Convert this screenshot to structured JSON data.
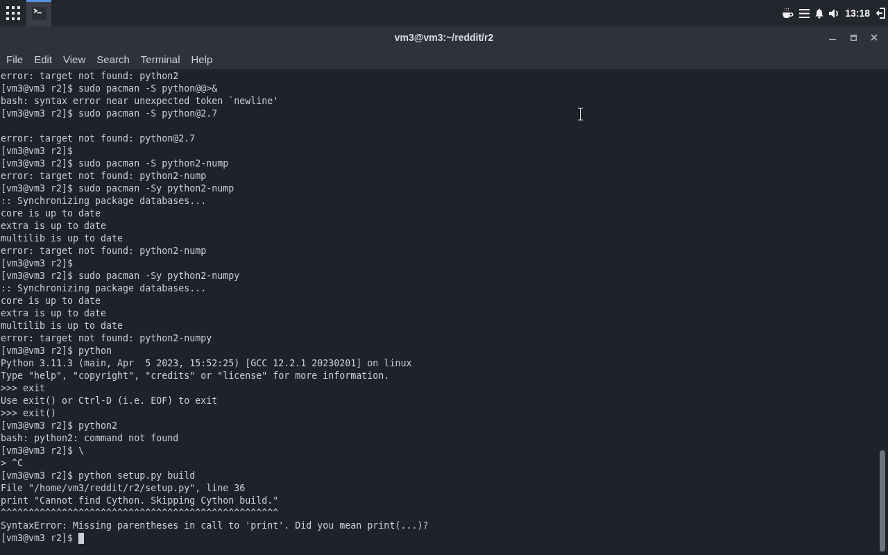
{
  "panel": {
    "tasks": [
      {
        "selected": true
      }
    ],
    "clock": "13:18"
  },
  "window": {
    "title": "vm3@vm3:~/reddit/r2"
  },
  "menu": [
    "File",
    "Edit",
    "View",
    "Search",
    "Terminal",
    "Help"
  ],
  "terminal": {
    "lines": [
      {
        "kind": "text",
        "text": "error: target not found: python2"
      },
      {
        "kind": "text",
        "text": "[vm3@vm3 r2]$ sudo pacman -S python@@>&"
      },
      {
        "kind": "text",
        "text": "bash: syntax error near unexpected token `newline'"
      },
      {
        "kind": "text",
        "text": "[vm3@vm3 r2]$ sudo pacman -S python@2.7"
      },
      {
        "kind": "blank"
      },
      {
        "kind": "text",
        "text": "error: target not found: python@2.7"
      },
      {
        "kind": "text",
        "text": "[vm3@vm3 r2]$"
      },
      {
        "kind": "text",
        "text": "[vm3@vm3 r2]$ sudo pacman -S python2-nump"
      },
      {
        "kind": "text",
        "text": "error: target not found: python2-nump"
      },
      {
        "kind": "text",
        "text": "[vm3@vm3 r2]$ sudo pacman -Sy python2-nump"
      },
      {
        "kind": "text",
        "text": ":: Synchronizing package databases..."
      },
      {
        "kind": "text",
        "text": " core is up to date"
      },
      {
        "kind": "text",
        "text": " extra is up to date"
      },
      {
        "kind": "text",
        "text": " multilib is up to date"
      },
      {
        "kind": "text",
        "text": "error: target not found: python2-nump"
      },
      {
        "kind": "text",
        "text": "[vm3@vm3 r2]$"
      },
      {
        "kind": "text",
        "text": "[vm3@vm3 r2]$ sudo pacman -Sy python2-numpy"
      },
      {
        "kind": "text",
        "text": ":: Synchronizing package databases..."
      },
      {
        "kind": "text",
        "text": " core is up to date"
      },
      {
        "kind": "text",
        "text": " extra is up to date"
      },
      {
        "kind": "text",
        "text": " multilib is up to date"
      },
      {
        "kind": "text",
        "text": "error: target not found: python2-numpy"
      },
      {
        "kind": "text",
        "text": "[vm3@vm3 r2]$ python"
      },
      {
        "kind": "text",
        "text": "Python 3.11.3 (main, Apr  5 2023, 15:52:25) [GCC 12.2.1 20230201] on linux"
      },
      {
        "kind": "text",
        "text": "Type \"help\", \"copyright\", \"credits\" or \"license\" for more information."
      },
      {
        "kind": "text",
        "text": ">>> exit"
      },
      {
        "kind": "text",
        "text": "Use exit() or Ctrl-D (i.e. EOF) to exit"
      },
      {
        "kind": "text",
        "text": ">>> exit()"
      },
      {
        "kind": "text",
        "text": "[vm3@vm3 r2]$ python2"
      },
      {
        "kind": "text",
        "text": "bash: python2: command not found"
      },
      {
        "kind": "text",
        "text": "[vm3@vm3 r2]$ \\"
      },
      {
        "kind": "text",
        "text": "> ^C"
      },
      {
        "kind": "text",
        "text": "[vm3@vm3 r2]$ python setup.py build"
      },
      {
        "kind": "text",
        "text": "  File \"/home/vm3/reddit/r2/setup.py\", line 36"
      },
      {
        "kind": "text",
        "text": "    print \"Cannot find Cython. Skipping Cython build.\""
      },
      {
        "kind": "text",
        "text": "    ^^^^^^^^^^^^^^^^^^^^^^^^^^^^^^^^^^^^^^^^^^^^^^^^^^"
      },
      {
        "kind": "text",
        "text": "SyntaxError: Missing parentheses in call to 'print'. Did you mean print(...)?"
      },
      {
        "kind": "prompt",
        "text": "[vm3@vm3 r2]$",
        "cursor": true
      }
    ]
  }
}
